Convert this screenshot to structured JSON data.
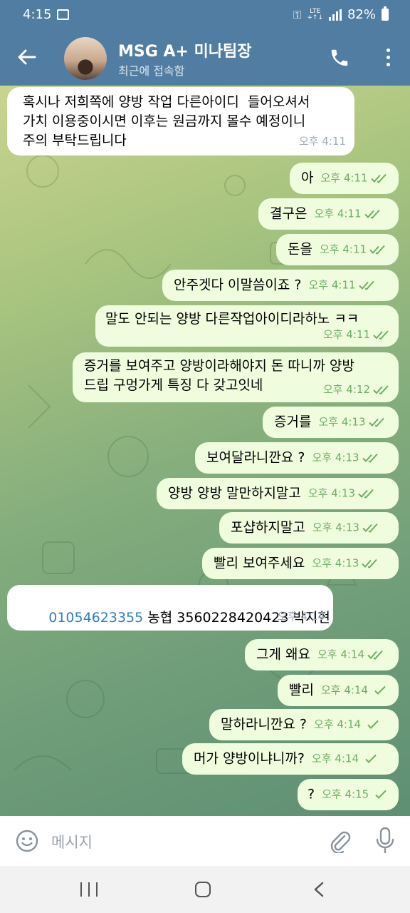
{
  "status_bar": {
    "time": "4:15",
    "network_top": "LTE",
    "network_bottom": "+↑↓",
    "battery": "82%"
  },
  "header": {
    "title": "MSG A+ 미나팀장",
    "subtitle": "최근에 접속함"
  },
  "messages": [
    {
      "dir": "in",
      "text": "혹시나 저희쪽에 양방 작업 다른아이디  들어오셔서\n가치 이용중이시면 이후는 원금까지 몰수 예정이니\n주의 부탁드립니다",
      "time": "오후 4:11"
    },
    {
      "dir": "out",
      "text": "아",
      "time": "오후 4:11",
      "read": true
    },
    {
      "dir": "out",
      "text": "결구은",
      "time": "오후 4:11",
      "read": true
    },
    {
      "dir": "out",
      "text": "돈을",
      "time": "오후 4:11",
      "read": true
    },
    {
      "dir": "out",
      "text": "안주겟다 이말씀이죠 ?",
      "time": "오후 4:11",
      "read": true
    },
    {
      "dir": "out",
      "text": "말도 안되는 양방 다른작업아이디라하노 ㅋㅋ",
      "time": "오후 4:11",
      "read": true
    },
    {
      "dir": "out",
      "text": "증거를 보여주고 양방이라해야지 돈 따니까 양방\n드립 구멍가게 특징 다 갖고잇네",
      "time": "오후 4:12",
      "read": true
    },
    {
      "dir": "out",
      "text": "증거를",
      "time": "오후 4:13",
      "read": true
    },
    {
      "dir": "out",
      "text": "보여달라니깐요 ?",
      "time": "오후 4:13",
      "read": true
    },
    {
      "dir": "out",
      "text": "양방 양방 말만하지말고",
      "time": "오후 4:13",
      "read": true
    },
    {
      "dir": "out",
      "text": "포샵하지말고",
      "time": "오후 4:13",
      "read": true
    },
    {
      "dir": "out",
      "text": "빨리 보여주세요",
      "time": "오후 4:13",
      "read": true
    },
    {
      "dir": "in",
      "link": "01054623355",
      "text": " 농협 3560228420423 박지현",
      "time": "오후 4:14"
    },
    {
      "dir": "out",
      "text": "그게 왜요",
      "time": "오후 4:14",
      "read": true
    },
    {
      "dir": "out",
      "text": "빨리",
      "time": "오후 4:14",
      "read": false
    },
    {
      "dir": "out",
      "text": "말하라니깐요 ?",
      "time": "오후 4:14",
      "read": false
    },
    {
      "dir": "out",
      "text": "머가 양방이냐니까?",
      "time": "오후 4:14",
      "read": false
    },
    {
      "dir": "out",
      "text": "?",
      "time": "오후 4:15",
      "read": false
    }
  ],
  "input": {
    "placeholder": "메시지"
  },
  "colors": {
    "header": "#517da2",
    "bubble_out": "#effdde",
    "bubble_in": "#ffffff",
    "check": "#6dae63"
  }
}
